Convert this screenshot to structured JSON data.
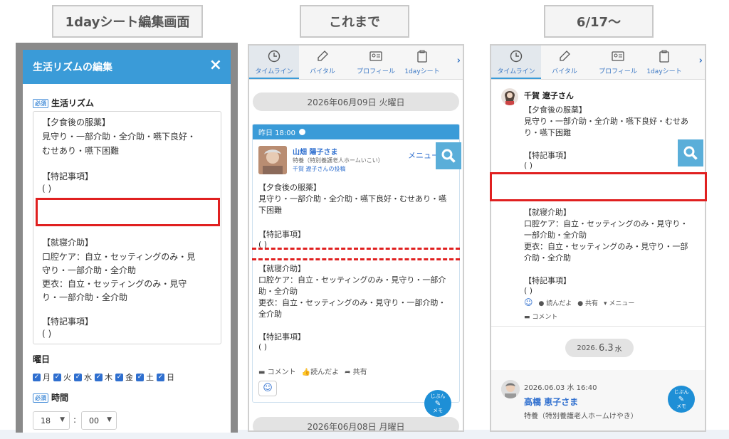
{
  "labels": {
    "p1": "1dayシート編集画面",
    "p2": "これまで",
    "p3": "6/17〜"
  },
  "editor": {
    "title": "生活リズムの編集",
    "close": "×",
    "required": "必須",
    "rhythm_label": "生活リズム",
    "text_lines": [
      "【夕食後の服薬】",
      "見守り・一部介助・全介助・嚥下良好・",
      "むせあり・嚥下困難",
      "【特記事項】",
      "(                              )",
      "【就寝介助】",
      "口腔ケア：自立・セッティングのみ・見",
      "守り・一部介助・全介助",
      "更衣：自立・セッティングのみ・見守",
      "り・一部介助・全介助",
      "【特記事項】",
      "(                              )"
    ],
    "weekday_label": "曜日",
    "days": [
      "月",
      "火",
      "水",
      "木",
      "金",
      "土",
      "日"
    ],
    "time_label": "時間",
    "hour": "18",
    "minute": "00",
    "colon": ":"
  },
  "tabs": [
    "タイムライン",
    "バイタル",
    "プロフィール",
    "1dayシート"
  ],
  "tab_more": "›",
  "timeline_old": {
    "date1": "2026年06月09日 火曜日",
    "card_time": "昨日 18:00",
    "name": "山畑 陽子さま",
    "facility": "特養（特別養護老人ホームいこい）",
    "poster": "千賀 遼子さんの投稿",
    "menu": "メニュー",
    "lines": [
      "【夕食後の服薬】",
      "見守り・一部介助・全介助・嚥下良好・むせあり・嚥",
      "下困難",
      "【特記事項】",
      "(          )",
      "【就寝介助】",
      "口腔ケア：自立・セッティングのみ・見守り・一部介",
      "助・全介助",
      "更衣：自立・セッティングのみ・見守り・一部介助・",
      "全介助",
      "【特記事項】",
      "(          )"
    ],
    "actions": [
      "コメント",
      "読んだよ",
      "共有"
    ],
    "fab": [
      "じぶん",
      "メモ"
    ],
    "date2": "2026年06月08日 月曜日"
  },
  "timeline_new": {
    "name": "千賀 遼子さん",
    "lines": [
      "【夕食後の服薬】",
      "見守り・一部介助・全介助・嚥下良好・むせあ",
      "り・嚥下困難",
      "【特記事項】",
      "(                          )",
      "【就寝介助】",
      "口腔ケア：自立・セッティングのみ・見守り・",
      "一部介助・全介助",
      "更衣：自立・セッティングのみ・見守り・一部",
      "介助・全介助",
      "【特記事項】",
      "(                          )"
    ],
    "actions": [
      "読んだよ",
      "共有",
      "メニュー"
    ],
    "comment": "コメント",
    "date_small": "2026.",
    "date_big": "6.3",
    "date_dow": "水",
    "post_time": "2026.06.03 水 16:40",
    "post_name": "高橋 恵子さま",
    "post_facility": "特養（特別養護老人ホームけやき）",
    "fab": [
      "じぶん",
      "メモ"
    ]
  },
  "colors": {
    "accent": "#3a9bd8",
    "highlight": "#e02020"
  }
}
